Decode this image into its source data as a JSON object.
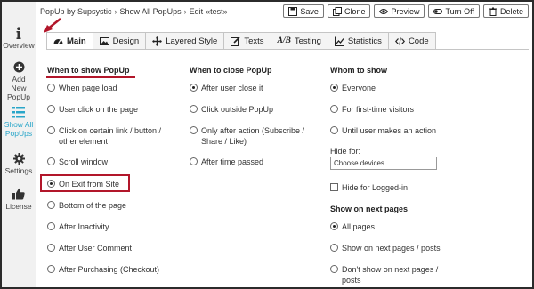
{
  "sidebar": {
    "items": [
      {
        "label": "Overview",
        "icon": "info-icon"
      },
      {
        "label": "Add New PopUp",
        "icon": "plus-circle-icon"
      },
      {
        "label": "Show All PopUps",
        "icon": "list-icon",
        "active": true
      },
      {
        "label": "Settings",
        "icon": "gear-icon"
      },
      {
        "label": "License",
        "icon": "thumbs-up-icon"
      }
    ]
  },
  "breadcrumbs": [
    "PopUp by Supsystic",
    "Show All PopUps",
    "Edit",
    "«test»"
  ],
  "toolbar": {
    "save": "Save",
    "clone": "Clone",
    "preview": "Preview",
    "turn_off": "Turn Off",
    "delete": "Delete"
  },
  "tabs": [
    "Main",
    "Design",
    "Layered Style",
    "Texts",
    "Testing",
    "Statistics",
    "Code"
  ],
  "tab_ab_prefix": "A/B",
  "when_show": {
    "title": "When to show PopUp",
    "options": [
      "When page load",
      "User click on the page",
      "Click on certain link / button / other element",
      "Scroll window",
      "On Exit from Site",
      "Bottom of the page",
      "After Inactivity",
      "After User Comment",
      "After Purchasing (Checkout)"
    ],
    "checked_index": 4
  },
  "when_close": {
    "title": "When to close PopUp",
    "options": [
      "After user close it",
      "Click outside PopUp",
      "Only after action (Subscribe / Share / Like)",
      "After time passed"
    ],
    "checked_index": 0
  },
  "whom": {
    "title": "Whom to show",
    "options": [
      "Everyone",
      "For first-time visitors",
      "Until user makes an action"
    ],
    "checked_index": 0,
    "hide_for_label": "Hide for:",
    "hide_for_placeholder": "Choose devices",
    "hide_logged_in": "Hide for Logged-in"
  },
  "next_pages": {
    "title": "Show on next pages",
    "options": [
      "All pages",
      "Show on next pages / posts",
      "Don't show on next pages / posts"
    ],
    "checked_index": 0
  },
  "colors": {
    "accent_red": "#b2162a",
    "active_sidebar": "#2aa6c9"
  }
}
